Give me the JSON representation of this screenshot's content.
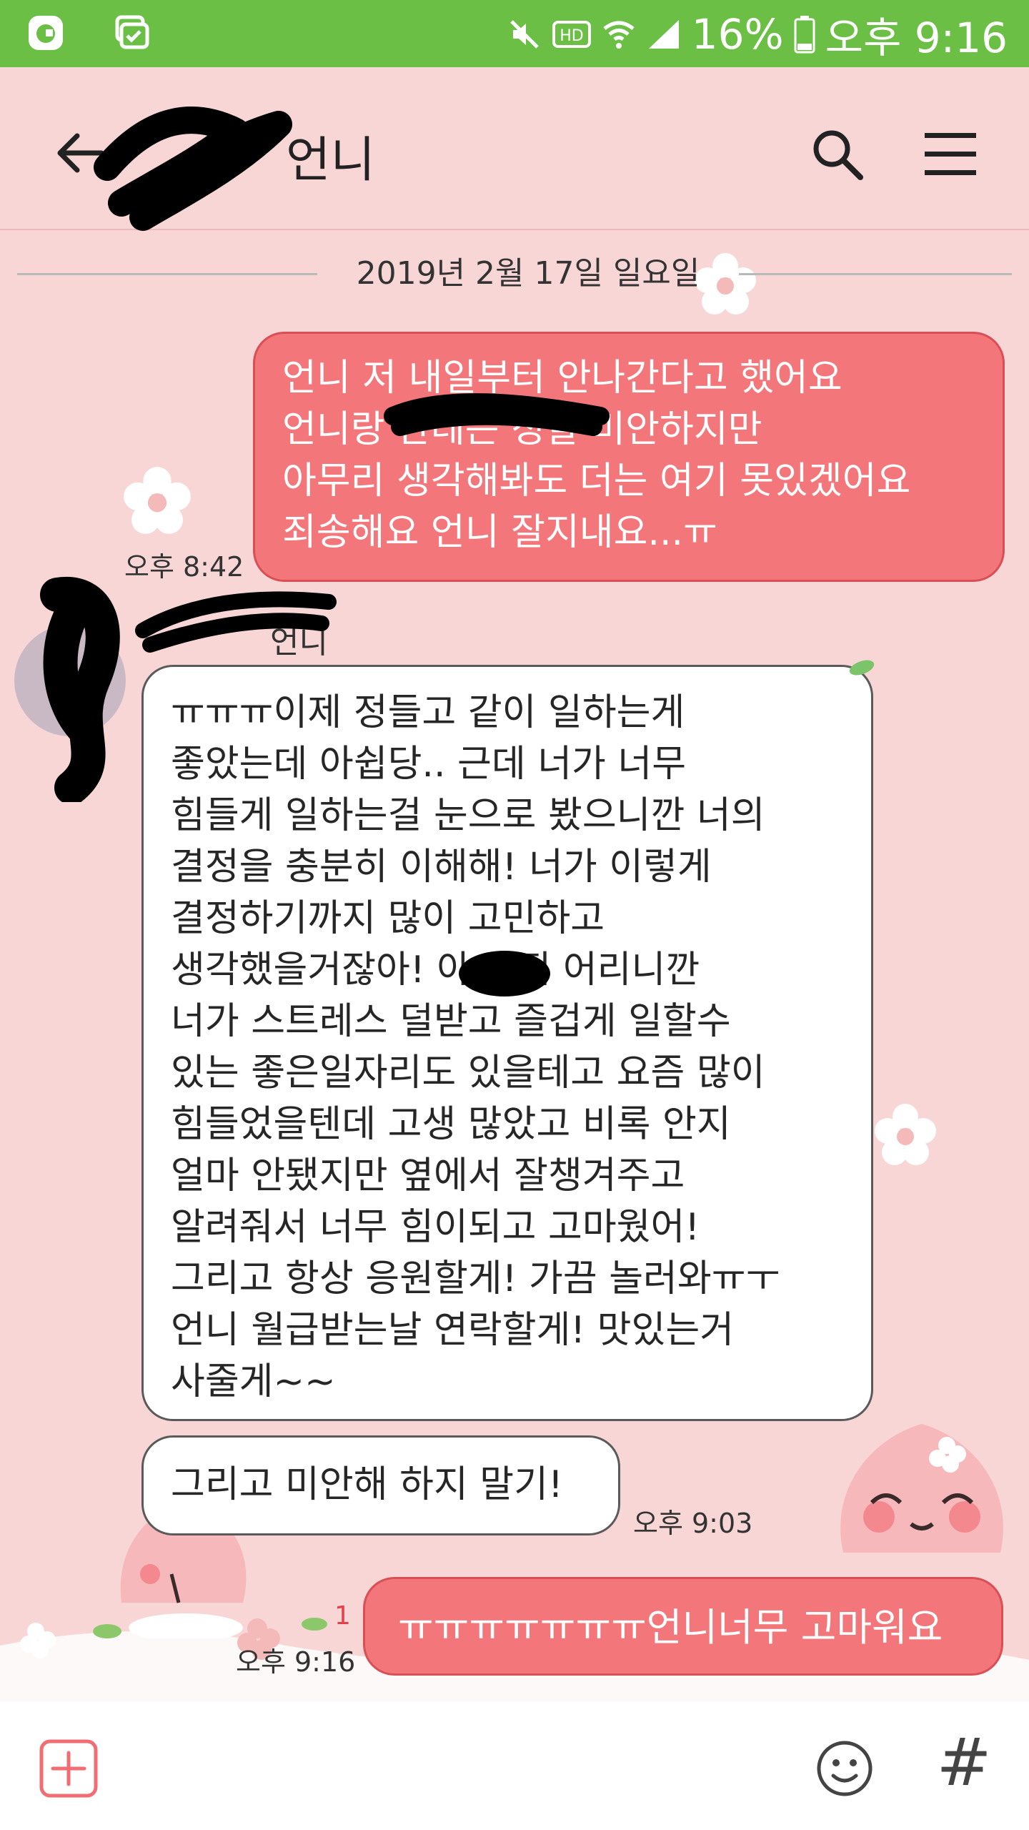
{
  "status_bar": {
    "battery": "16%",
    "time": "오후 9:16"
  },
  "header": {
    "title": "언니"
  },
  "chat": {
    "date_divider": "2019년 2월 17일 일요일",
    "sender_name": "언니",
    "messages": [
      {
        "direction": "sent",
        "text": "언니 저 내일부터 안나간다고 했어요\n언니랑        한테는 정말 미안하지만\n아무리 생각해봐도 더는 여기 못있겠어요\n죄송해요 언니 잘지내요...ㅠ",
        "time": "오후 8:42"
      },
      {
        "direction": "received",
        "text": "ㅠㅠㅠ이제 정들고 같이 일하는게\n좋았는데 아쉽당.. 근데 너가 너무\n힘들게 일하는걸 눈으로 봤으니깐 너의\n결정을 충분히 이해해! 너가 이렇게\n결정하기까지 많이 고민하고\n생각했을거잖아!       아 아직 어리니깐\n너가 스트레스 덜받고 즐겁게 일할수\n있는 좋은일자리도 있을테고 요즘 많이\n힘들었을텐데 고생 많았고 비록 안지\n얼마 안됐지만 옆에서 잘챙겨주고\n알려줘서 너무 힘이되고 고마웠어!\n그리고 항상 응원할게! 가끔 놀러와ㅠㅜ\n언니 월급받는날 연락할게! 맛있는거\n사줄게~~"
      },
      {
        "direction": "received",
        "text": "그리고 미안해 하지 말기!",
        "time": "오후 9:03"
      },
      {
        "direction": "sent",
        "text": "ㅠㅠㅠㅠㅠㅠㅠ언니너무 고마워요",
        "time": "오후 9:16",
        "unread_count": "1"
      }
    ]
  },
  "input_bar": {
    "hash_label": "#"
  },
  "colors": {
    "status_bar": "#6cbf45",
    "background": "#f9d6d6",
    "sent_bubble": "#f3767a",
    "received_bubble": "#ffffff"
  }
}
